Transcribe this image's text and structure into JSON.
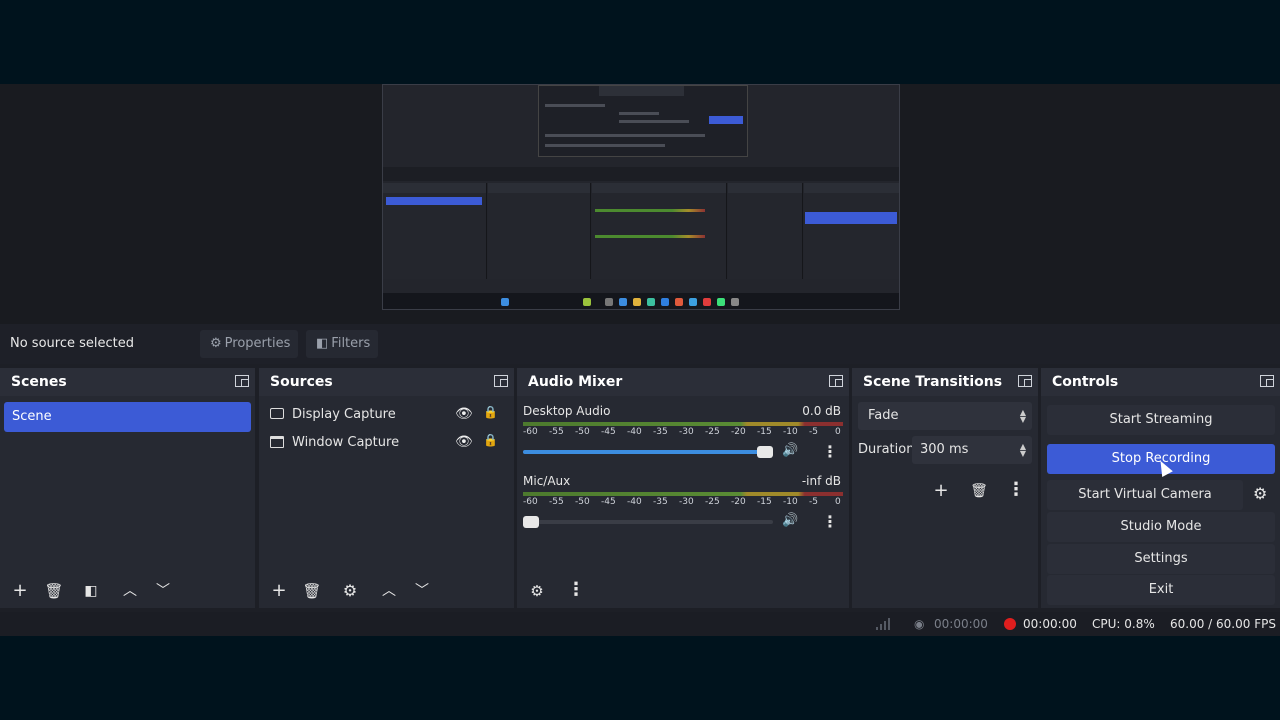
{
  "source_bar": {
    "no_source": "No source selected",
    "properties": "Properties",
    "filters": "Filters"
  },
  "scenes": {
    "title": "Scenes",
    "items": [
      "Scene"
    ]
  },
  "sources": {
    "title": "Sources",
    "items": [
      "Display Capture",
      "Window Capture"
    ]
  },
  "audio_mixer": {
    "title": "Audio Mixer",
    "ticks": [
      "-60",
      "-55",
      "-50",
      "-45",
      "-40",
      "-35",
      "-30",
      "-25",
      "-20",
      "-15",
      "-10",
      "-5",
      "0"
    ],
    "channels": [
      {
        "name": "Desktop Audio",
        "db": "0.0 dB",
        "volume": 1.0
      },
      {
        "name": "Mic/Aux",
        "db": "-inf dB",
        "volume": 0.0
      }
    ]
  },
  "transitions": {
    "title": "Scene Transitions",
    "selected": "Fade",
    "duration_label": "Duration",
    "duration_value": "300 ms"
  },
  "controls": {
    "title": "Controls",
    "start_streaming": "Start Streaming",
    "stop_recording": "Stop Recording",
    "start_virtual_camera": "Start Virtual Camera",
    "studio_mode": "Studio Mode",
    "settings": "Settings",
    "exit": "Exit"
  },
  "status": {
    "stream_time": "00:00:00",
    "rec_time": "00:00:00",
    "cpu": "CPU: 0.8%",
    "fps": "60.00 / 60.00 FPS"
  },
  "colors": {
    "accent": "#3c5bd6",
    "panel": "#262932",
    "rec": "#e01e1e"
  }
}
